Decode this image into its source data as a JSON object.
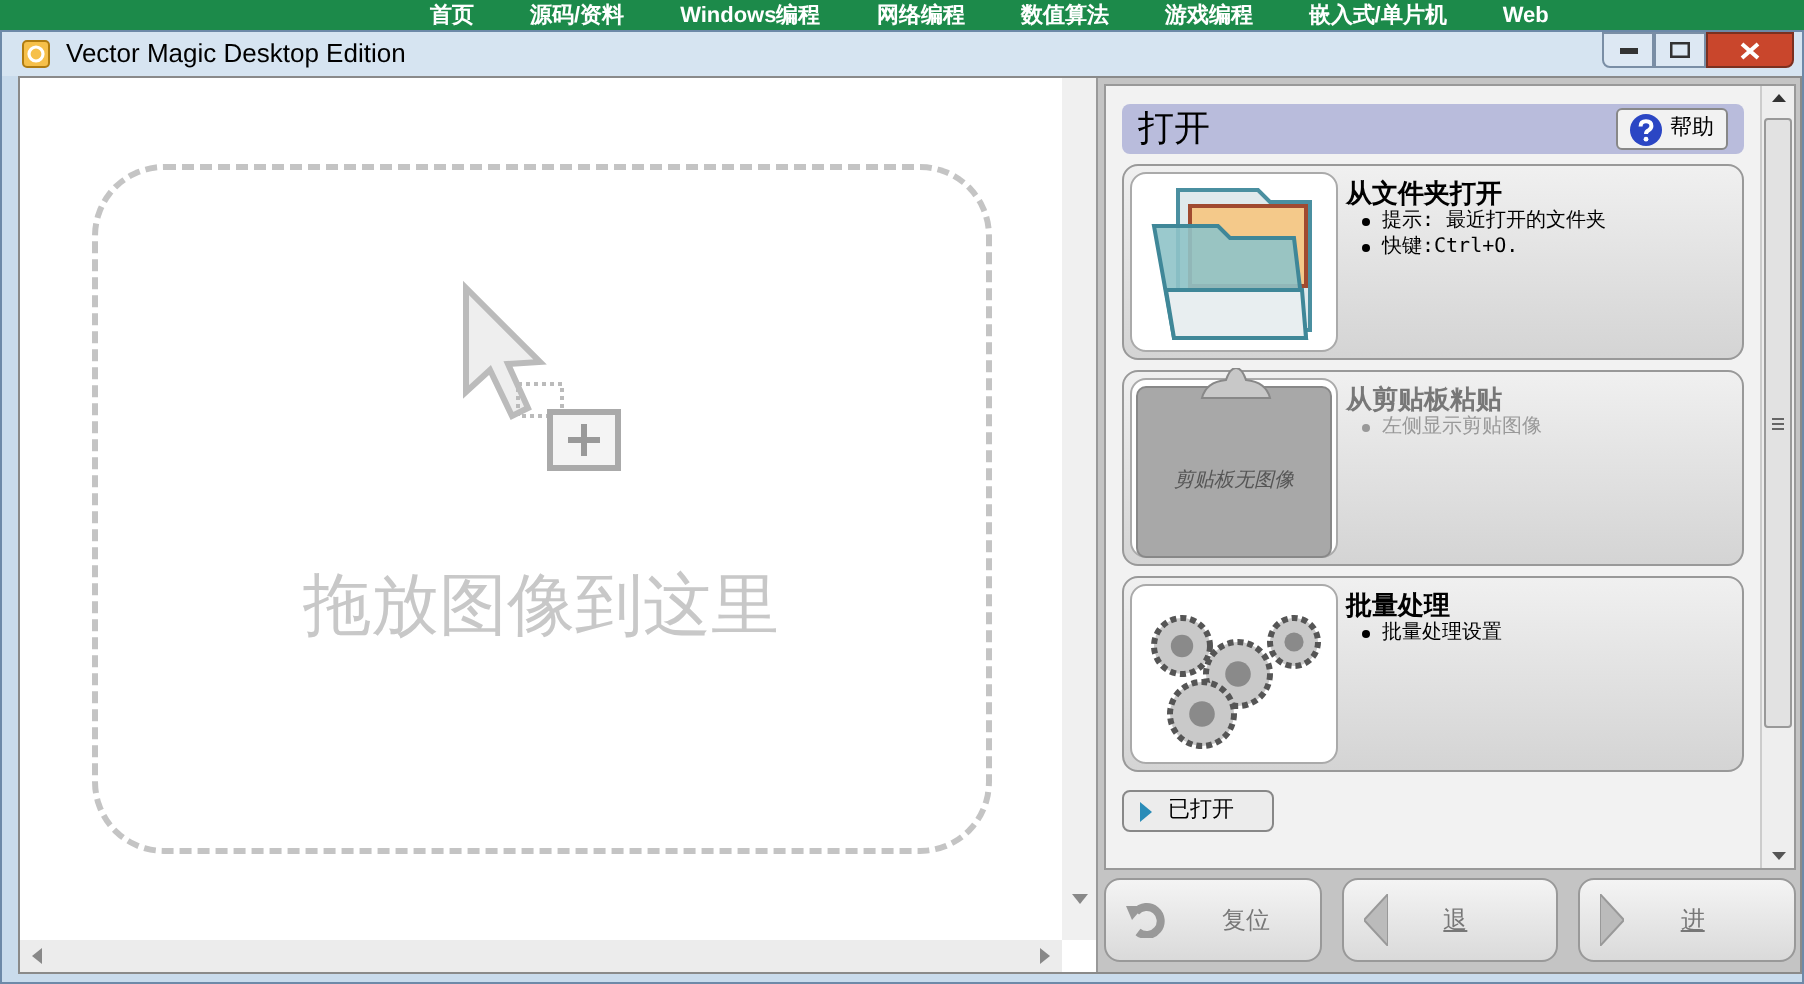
{
  "background_nav": [
    "首页",
    "源码/资料",
    "Windows编程",
    "网络编程",
    "数值算法",
    "游戏编程",
    "嵌入式/单片机",
    "Web"
  ],
  "window": {
    "title": "Vector Magic Desktop Edition"
  },
  "drop_zone": {
    "text": "拖放图像到这里"
  },
  "open_panel": {
    "title": "打开",
    "help_button": "帮助",
    "options": [
      {
        "kind": "folder",
        "title": "从文件夹打开",
        "bullets": [
          "提示: 最近打开的文件夹",
          "快键:Ctrl+O."
        ],
        "disabled": false
      },
      {
        "kind": "clipboard",
        "title": "从剪贴板粘贴",
        "bullets": [
          "左侧显示剪贴图像"
        ],
        "disabled": true,
        "thumb_text": "剪贴板无图像"
      },
      {
        "kind": "gears",
        "title": "批量处理",
        "bullets": [
          "批量处理设置"
        ],
        "disabled": false
      }
    ],
    "recent_button": "已打开"
  },
  "nav_buttons": [
    {
      "kind": "reset",
      "label": "复位",
      "underline": false
    },
    {
      "kind": "back",
      "label": "退",
      "underline": true
    },
    {
      "kind": "forward",
      "label": "进",
      "underline": true
    }
  ]
}
